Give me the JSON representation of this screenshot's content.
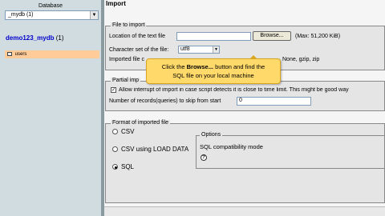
{
  "nav": {
    "db_label": "Database",
    "db_select_value": "_mydb (1)",
    "db_name": "demo123_mydb",
    "db_count": "(1)",
    "table_name": "users"
  },
  "page": {
    "title": "Import"
  },
  "file_import": {
    "legend": "File to import",
    "location_label": "Location of the text file",
    "location_value": "",
    "browse_label": "Browse...",
    "max_label": "(Max: 51,200 KiB)",
    "charset_label": "Character set of the file:",
    "charset_value": "utf8",
    "compression_label": "Imported file c",
    "compression_tail": "None, gzip, zip"
  },
  "partial_import": {
    "legend": "Partial imp",
    "interrupt_label": "Allow interrupt of import in case script detects it is close to time limit. This might be good way",
    "interrupt_checked": true,
    "skip_label": "Number of records(queries) to skip from start",
    "skip_value": "0"
  },
  "format": {
    "legend": "Format of imported file",
    "options": [
      "CSV",
      "CSV using LOAD DATA",
      "SQL"
    ],
    "selected": "SQL",
    "options_box_legend": "Options",
    "sql_compat_label": "SQL compatibility mode"
  },
  "callout": {
    "prefix": "Click the ",
    "strong": "Browse...",
    "suffix": " button and find the",
    "line2": "SQL file on your local machine"
  },
  "colors": {
    "nav_bg": "#d0dce0",
    "highlight": "#ffcc99",
    "callout_bg": "#ffd96a",
    "link": "#0000cc"
  }
}
